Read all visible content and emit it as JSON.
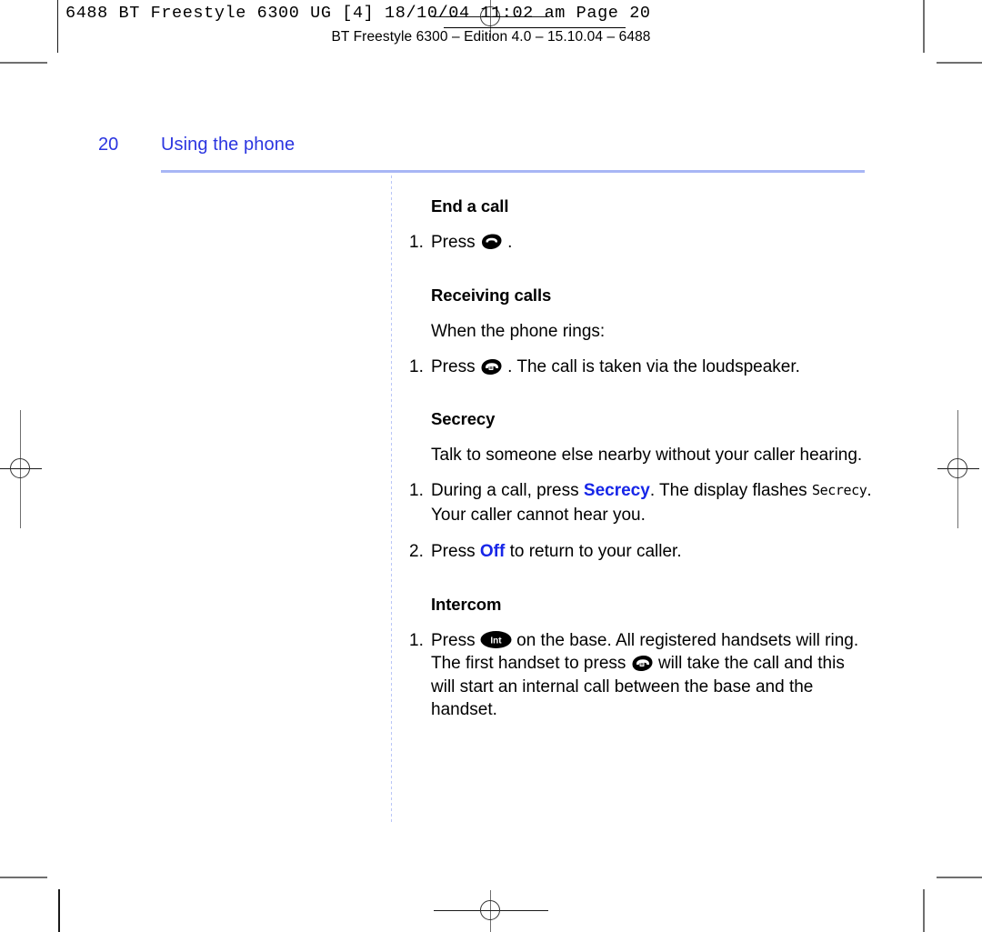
{
  "printer_slug": {
    "text": "6488 BT Freestyle 6300 UG [4]  18/10/04  11:02 am  Page 20",
    "edition_line": "BT Freestyle 6300 – Edition 4.0 – 15.10.04 – 6488"
  },
  "header": {
    "folio": "20",
    "running_head": "Using the phone",
    "accent_color": "#2b35e0",
    "rule_color": "#a8b6f5"
  },
  "sections": [
    {
      "id": "end-a-call",
      "heading": "End a call",
      "steps": [
        {
          "number": "1.",
          "parts": [
            {
              "type": "text",
              "value": "Press "
            },
            {
              "type": "icon",
              "name": "end-call-key-icon"
            },
            {
              "type": "text",
              "value": " ."
            }
          ]
        }
      ]
    },
    {
      "id": "receiving-calls",
      "heading": "Receiving calls",
      "intro": "When the phone rings:",
      "steps": [
        {
          "number": "1.",
          "parts": [
            {
              "type": "text",
              "value": "Press "
            },
            {
              "type": "icon",
              "name": "talk-loudspeaker-key-icon"
            },
            {
              "type": "text",
              "value": " . The call is taken via the loudspeaker."
            }
          ]
        }
      ]
    },
    {
      "id": "secrecy",
      "heading": "Secrecy",
      "intro": "Talk to someone else nearby without your caller hearing.",
      "steps": [
        {
          "number": "1.",
          "line1_a": "During a call, press ",
          "line1_key": "Secrecy",
          "line1_b": ". The display flashes ",
          "line1_lcd": "Secrecy",
          "line1_c": ".",
          "line2": "Your caller cannot hear you."
        },
        {
          "number": "2.",
          "line1_a": "Press ",
          "line1_key": "Off",
          "line1_b": " to return to your caller."
        }
      ]
    },
    {
      "id": "intercom",
      "heading": "Intercom",
      "steps": [
        {
          "number": "1.",
          "seg_a": "Press ",
          "icon_a": "intercom-key-icon",
          "seg_b": " on the base. All registered handsets will ring. The first handset to press ",
          "icon_b": "talk-loudspeaker-key-icon",
          "seg_c": " will take the call and this will start an internal call between the base and the handset."
        }
      ]
    }
  ],
  "icons": {
    "end_call_label": "end-call",
    "talk_label": "talk",
    "intercom_label": "Int"
  },
  "colors": {
    "key_text": "#1726e8",
    "heading": "#000000",
    "body": "#000000"
  }
}
